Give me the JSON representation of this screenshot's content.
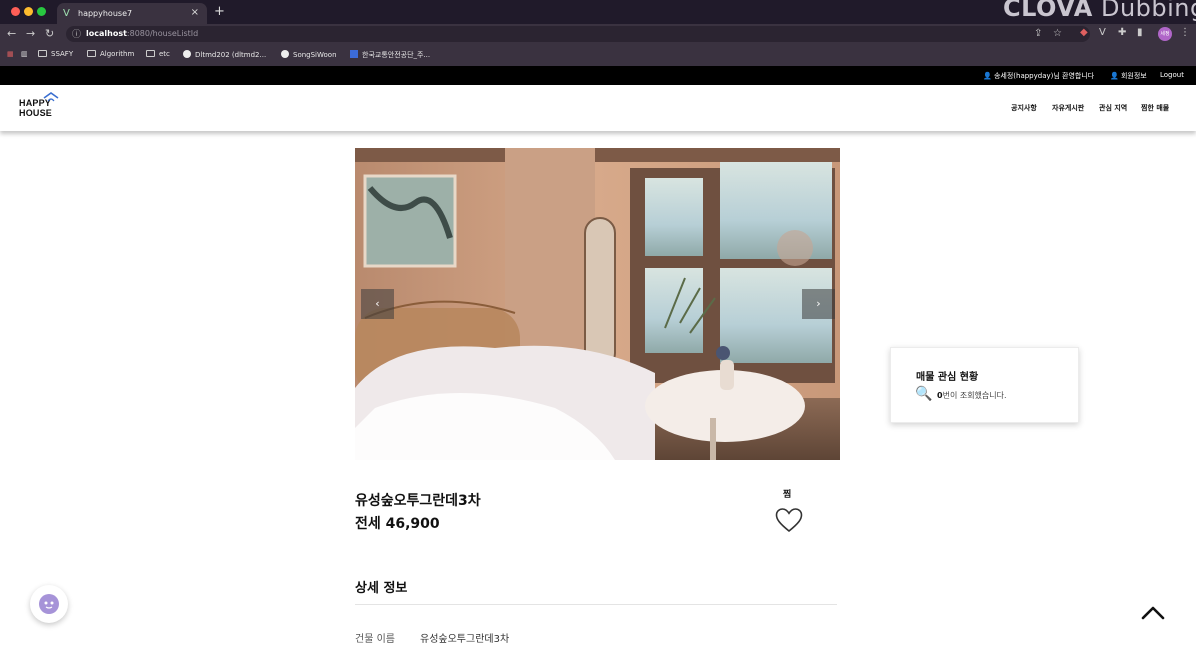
{
  "browser": {
    "tab_title": "happyhouse7",
    "tab_favicon": "V",
    "url_host": "localhost",
    "url_rest": ":8080/houseListId",
    "bookmarks": [
      "SSAFY",
      "Algorithm",
      "etc",
      "Dltmd202 (dltmd2...",
      "SongSiWoon",
      "한국교통안전공단_주..."
    ],
    "overlay_brand_bold": "CLOVA",
    "overlay_brand_rest": "Dubbing",
    "profile_initials": "세정"
  },
  "topbar": {
    "greeting": "송세정(happyday)님 환영합니다",
    "member_info": "회원정보",
    "logout": "Logout"
  },
  "header": {
    "logo_line1": "HAPPY",
    "logo_line2": "HOUSE",
    "nav": [
      "공지사항",
      "자유게시판",
      "관심 지역",
      "찜한 매물"
    ]
  },
  "carousel": {
    "prev_label": "‹",
    "next_label": "›"
  },
  "property": {
    "name": "유성숲오투그란데3차",
    "price": "전세 46,900",
    "like_label": "찜"
  },
  "interest": {
    "title": "매물 관심 현황",
    "count": "0",
    "suffix": "번이 조회했습니다."
  },
  "details": {
    "section_title": "상세 정보",
    "rows": [
      {
        "key": "건물 이름",
        "value": "유성숲오투그란데3차"
      }
    ]
  },
  "colors": {
    "accent": "#a693d8",
    "topbar": "#000000",
    "chrome": "#3a3240"
  }
}
